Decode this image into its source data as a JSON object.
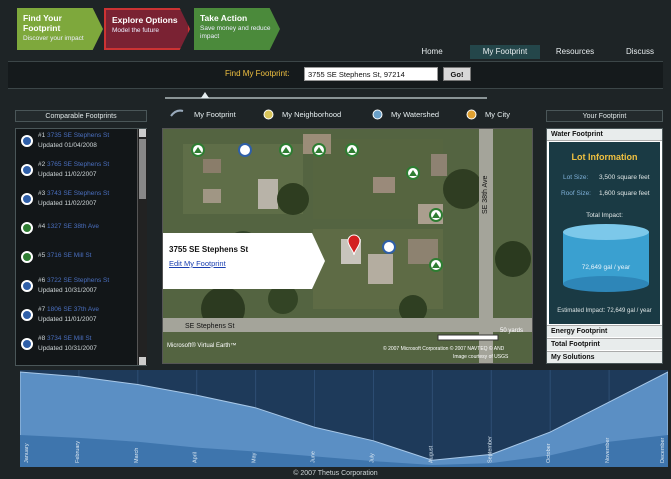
{
  "steps": [
    {
      "title": "Find Your Footprint",
      "subtitle": "Discover your impact"
    },
    {
      "title": "Explore  Options",
      "subtitle": "Model the future"
    },
    {
      "title": "Take Action",
      "subtitle": "Save money and reduce impact"
    }
  ],
  "nav": [
    "Home",
    "My Footprint",
    "Resources",
    "Discuss"
  ],
  "find": {
    "label": "Find My Footprint:",
    "value": "3755 SE Stephens St, 97214",
    "button": "Go!"
  },
  "left": {
    "heading": "Comparable Footprints",
    "items": [
      {
        "rank": "#1",
        "name": "3735 SE Stephens St",
        "updated": "Updated 01/04/2008"
      },
      {
        "rank": "#2",
        "name": "3765 SE Stephens St",
        "updated": "Updated 11/02/2007"
      },
      {
        "rank": "#3",
        "name": "3743 SE Stephens St",
        "updated": "Updated 11/02/2007"
      },
      {
        "rank": "#4",
        "name": "1327 SE 38th Ave",
        "updated": ""
      },
      {
        "rank": "#5",
        "name": "3716 SE Mill St",
        "updated": ""
      },
      {
        "rank": "#6",
        "name": "3722 SE Stephens St",
        "updated": "Updated 10/31/2007"
      },
      {
        "rank": "#7",
        "name": "1806 SE 37th Ave",
        "updated": "Updated 11/01/2007"
      },
      {
        "rank": "#8",
        "name": "3734 SE Mill St",
        "updated": "Updated 10/31/2007"
      }
    ]
  },
  "maptabs": [
    "My Footprint",
    "My Neighborhood",
    "My Watershed",
    "My City"
  ],
  "map": {
    "popup_title": "3755 SE Stephens St",
    "popup_link": "Edit My Footprint",
    "street1": "SE Stephens St",
    "street2": "SE 38th Ave",
    "brand": "Microsoft® Virtual Earth™",
    "credit": "© 2007 Microsoft Corporation  © 2007 NAVTEQ  © AND",
    "credit2": "Image courtesy of USGS",
    "scale": "50 yards"
  },
  "right": {
    "heading": "Your Footprint",
    "section": "Water Footprint",
    "lot_title": "Lot Information",
    "lot_size_label": "Lot Size:",
    "lot_size": "3,500 square feet",
    "roof_label": "Roof Size:",
    "roof_size": "1,600 square feet",
    "total_label": "Total Impact:",
    "total_value": "72,649 gal / year",
    "estimate": "Estimated Impact: 72,649 gal / year",
    "accordion": [
      "Energy Footprint",
      "Total Footprint",
      "My Solutions"
    ]
  },
  "colors": {
    "step1": "#7ea83c",
    "step2": "#7a2233",
    "step3": "#4b8a3b",
    "accent": "#f0c040"
  },
  "chart_data": {
    "type": "area",
    "categories": [
      "January",
      "February",
      "March",
      "April",
      "May",
      "June",
      "July",
      "August",
      "September",
      "October",
      "November",
      "December"
    ],
    "series": [
      {
        "values": [
          0.98,
          0.93,
          0.85,
          0.74,
          0.61,
          0.41,
          0.27,
          0.07,
          0.13,
          0.36,
          0.67,
          0.98
        ]
      },
      {
        "values": [
          0.33,
          0.3,
          0.26,
          0.2,
          0.16,
          0.11,
          0.06,
          0.02,
          0.04,
          0.12,
          0.26,
          0.33
        ]
      }
    ],
    "ylim": [
      0,
      1
    ]
  },
  "footer": "© 2007 Thetus Corporation"
}
